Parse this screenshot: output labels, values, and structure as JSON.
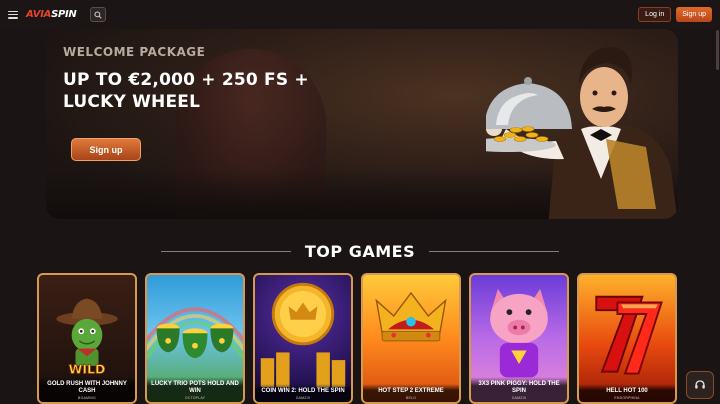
{
  "header": {
    "logo": {
      "part1": "AVIA",
      "part2": "SPIN"
    },
    "login_label": "Log in",
    "signup_label": "Sign up"
  },
  "hero": {
    "welcome": "WELCOME PACKAGE",
    "headline": "UP TO €2,000 + 250 FS + LUCKY WHEEL",
    "cta_label": "Sign up"
  },
  "top_games": {
    "title": "TOP GAMES",
    "items": [
      {
        "name": "GOLD RUSH WITH JOHNNY CASH",
        "provider": "BGAMING",
        "art": "cowboy-cactus"
      },
      {
        "name": "LUCKY TRIO POTS HOLD AND WIN",
        "provider": "OCTOPLAY",
        "art": "pots-of-gold"
      },
      {
        "name": "COIN WIN 2: HOLD THE SPIN",
        "provider": "GAMZIX",
        "art": "gold-coin"
      },
      {
        "name": "HOT STEP 2 EXTREME",
        "provider": "BELO",
        "art": "crown"
      },
      {
        "name": "3X3 PINK PIGGY: HOLD THE SPIN",
        "provider": "GAMZIX",
        "art": "pink-pig"
      },
      {
        "name": "HELL HOT 100",
        "provider": "ENDORPHINA",
        "art": "lucky-seven"
      }
    ]
  },
  "colors": {
    "accent": "#e06a2a",
    "card_border": "#d79a4c",
    "background": "#1a1414"
  }
}
